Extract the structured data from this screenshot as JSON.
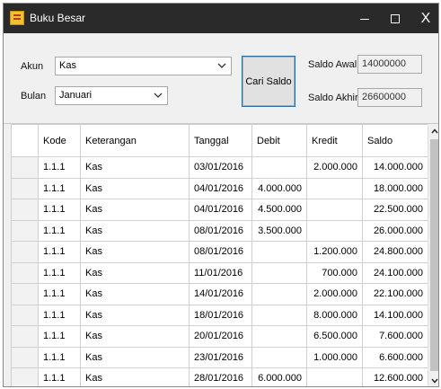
{
  "window": {
    "title": "Buku Besar",
    "close_glyph": "X"
  },
  "form": {
    "akun_label": "Akun",
    "akun_value": "Kas",
    "bulan_label": "Bulan",
    "bulan_value": "Januari",
    "cari_button": "Cari Saldo",
    "saldo_awal_label": "Saldo Awal",
    "saldo_awal_value": "14000000",
    "saldo_akhir_label": "Saldo Akhir",
    "saldo_akhir_value": "26600000"
  },
  "grid": {
    "columns": [
      "Kode",
      "Keterangan",
      "Tanggal",
      "Debit",
      "Kredit",
      "Saldo"
    ],
    "rows": [
      [
        "1.1.1",
        "Kas",
        "03/01/2016",
        "",
        "2.000.000",
        "14.000.000"
      ],
      [
        "1.1.1",
        "Kas",
        "04/01/2016",
        "4.000.000",
        "",
        "18.000.000"
      ],
      [
        "1.1.1",
        "Kas",
        "04/01/2016",
        "4.500.000",
        "",
        "22.500.000"
      ],
      [
        "1.1.1",
        "Kas",
        "08/01/2016",
        "3.500.000",
        "",
        "26.000.000"
      ],
      [
        "1.1.1",
        "Kas",
        "08/01/2016",
        "",
        "1.200.000",
        "24.800.000"
      ],
      [
        "1.1.1",
        "Kas",
        "11/01/2016",
        "",
        "700.000",
        "24.100.000"
      ],
      [
        "1.1.1",
        "Kas",
        "14/01/2016",
        "",
        "2.000.000",
        "22.100.000"
      ],
      [
        "1.1.1",
        "Kas",
        "18/01/2016",
        "",
        "8.000.000",
        "14.100.000"
      ],
      [
        "1.1.1",
        "Kas",
        "20/01/2016",
        "",
        "6.500.000",
        "7.600.000"
      ],
      [
        "1.1.1",
        "Kas",
        "23/01/2016",
        "",
        "1.000.000",
        "6.600.000"
      ],
      [
        "1.1.1",
        "Kas",
        "28/01/2016",
        "6.000.000",
        "",
        "12.600.000"
      ]
    ]
  },
  "icons": {
    "app": "ledger-app-icon",
    "minimize": "minimize-icon",
    "maximize": "maximize-icon",
    "close": "close-icon",
    "dropdown": "chevron-down-icon",
    "scroll_up": "scroll-up-arrow-icon",
    "scroll_down": "scroll-down-arrow-icon"
  },
  "colors": {
    "titlebar": "#2a2a2a",
    "button_focus_border": "#0078d7",
    "grid_line": "#cfcfcf"
  }
}
